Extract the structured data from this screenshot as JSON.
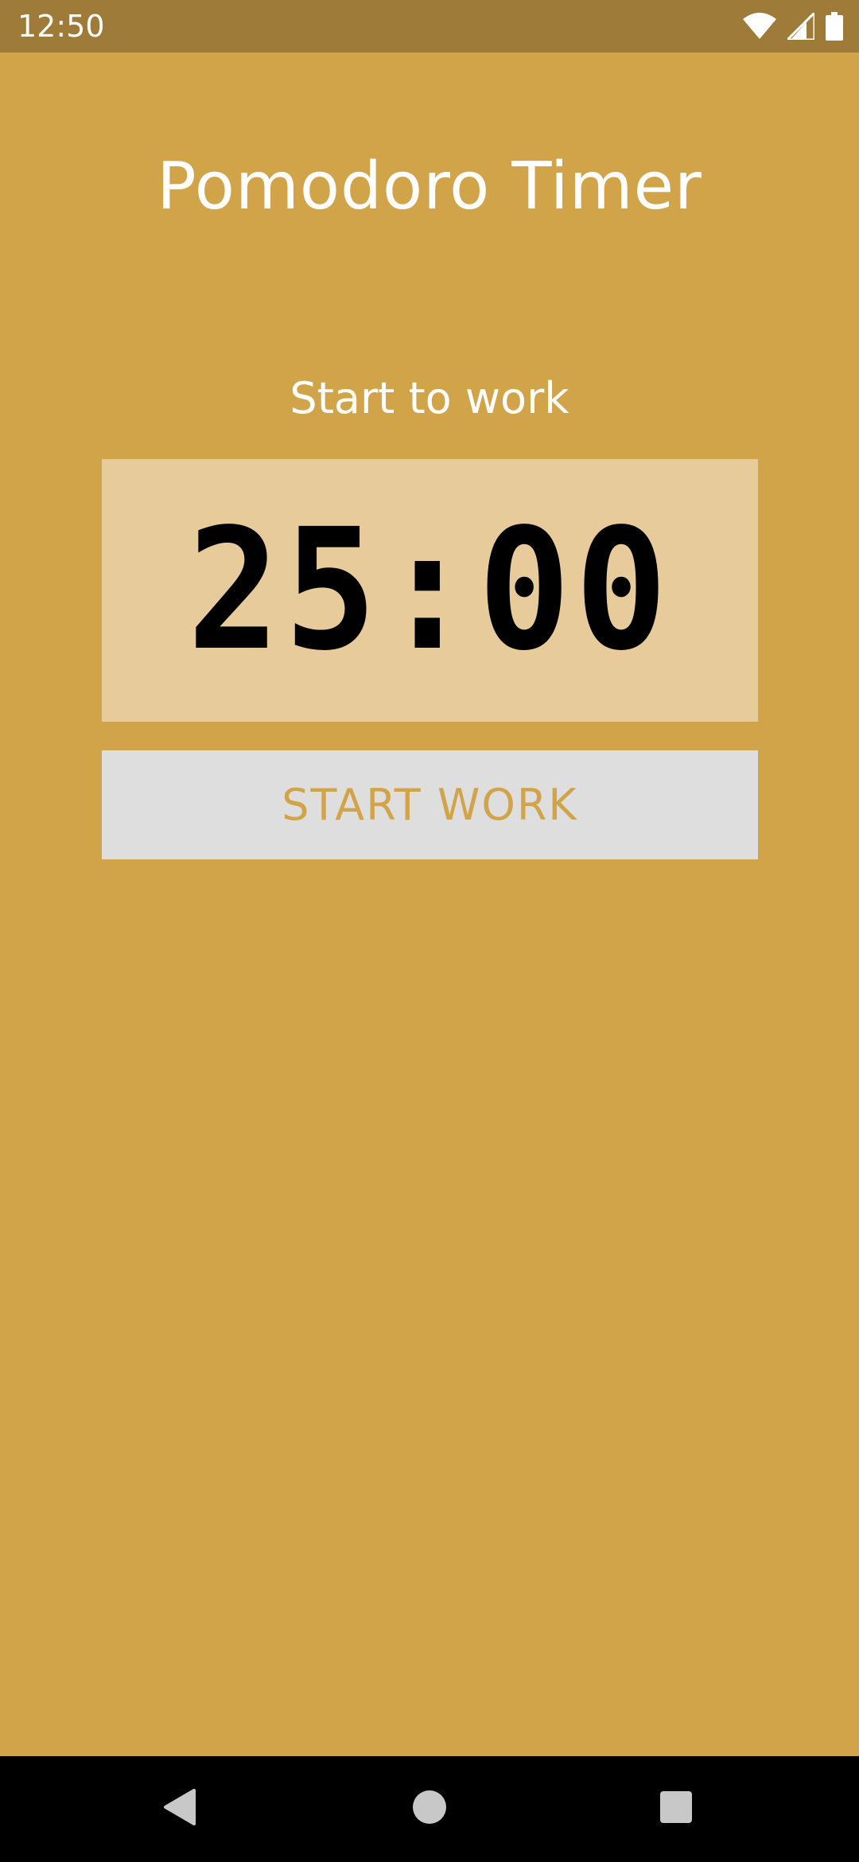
{
  "status_bar": {
    "time": "12:50",
    "icons": [
      "wifi-icon",
      "cellular-signal-icon",
      "battery-icon"
    ]
  },
  "app": {
    "title": "Pomodoro Timer",
    "subtitle": "Start to work",
    "timer": "25:00",
    "start_button_label": "START WORK"
  },
  "nav_bar": {
    "buttons": [
      "back-icon",
      "home-icon",
      "recents-icon"
    ]
  },
  "colors": {
    "background": "#D1A449",
    "status_bar": "#9E7B38",
    "timer_box": "#E8CB9A",
    "button_bg": "#DEDEDE",
    "button_text": "#D1A449",
    "nav_bar": "#000000"
  }
}
